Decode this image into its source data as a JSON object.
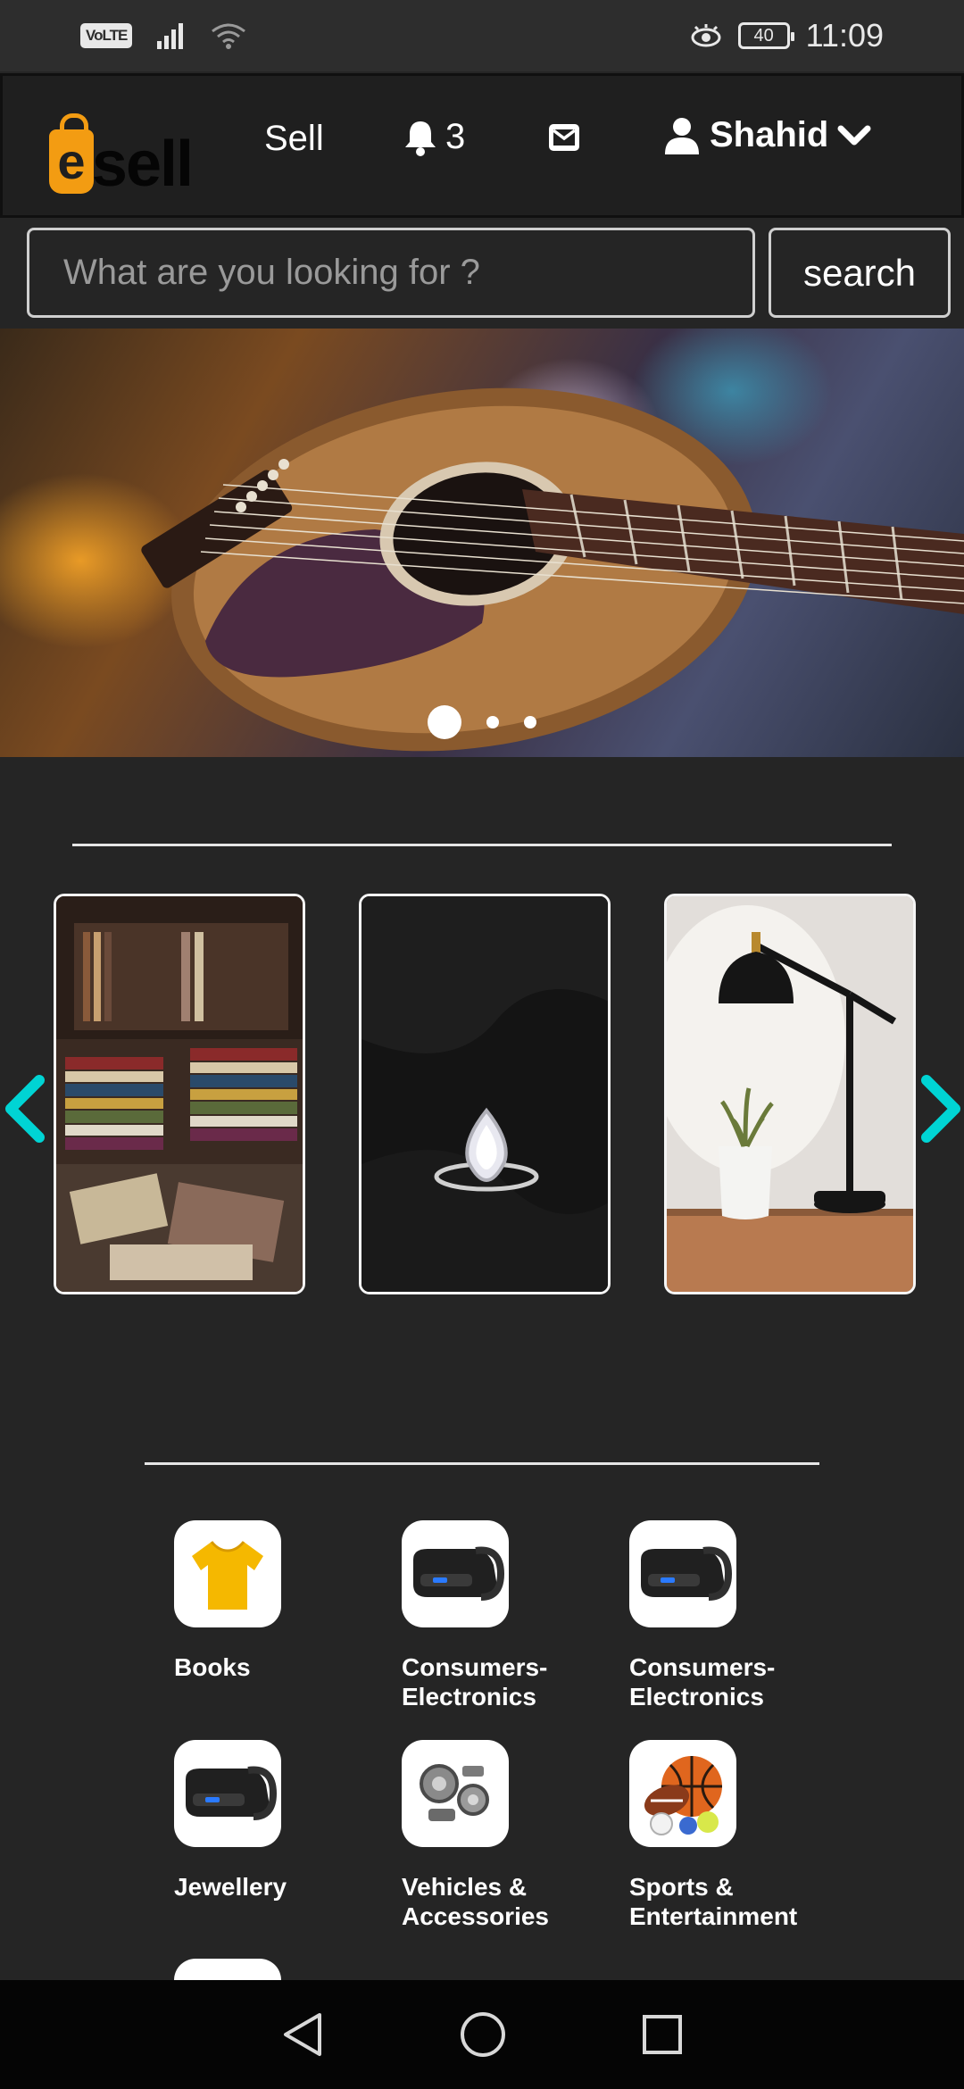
{
  "status_bar": {
    "volte": "VoLTE",
    "battery": "40",
    "time": "11:09"
  },
  "header": {
    "logo_letter": "e",
    "logo_text": "sell",
    "sell_label": "Sell",
    "notification_count": "3",
    "user_name": "Shahid"
  },
  "search": {
    "placeholder": "What are you looking for ?",
    "button_label": "search"
  },
  "banner": {
    "slide_count": 3,
    "active_slide": 1
  },
  "featured": {
    "items": [
      {
        "subject": "books"
      },
      {
        "subject": "ring"
      },
      {
        "subject": "lamp"
      }
    ]
  },
  "categories": [
    {
      "label": "Books",
      "icon": "tshirt-icon"
    },
    {
      "label": "Consumers-\nElectronics",
      "icon": "vr-headset-icon"
    },
    {
      "label": "Consumers-\nElectronics",
      "icon": "vr-headset-icon"
    },
    {
      "label": "Jewellery",
      "icon": "vr-headset-icon"
    },
    {
      "label": "Vehicles &\nAccessories",
      "icon": "car-parts-icon"
    },
    {
      "label": "Sports &\nEntertainment",
      "icon": "sports-balls-icon"
    }
  ],
  "colors": {
    "accent": "#00d4d4",
    "logo_orange": "#f39c12",
    "background": "#252525"
  }
}
